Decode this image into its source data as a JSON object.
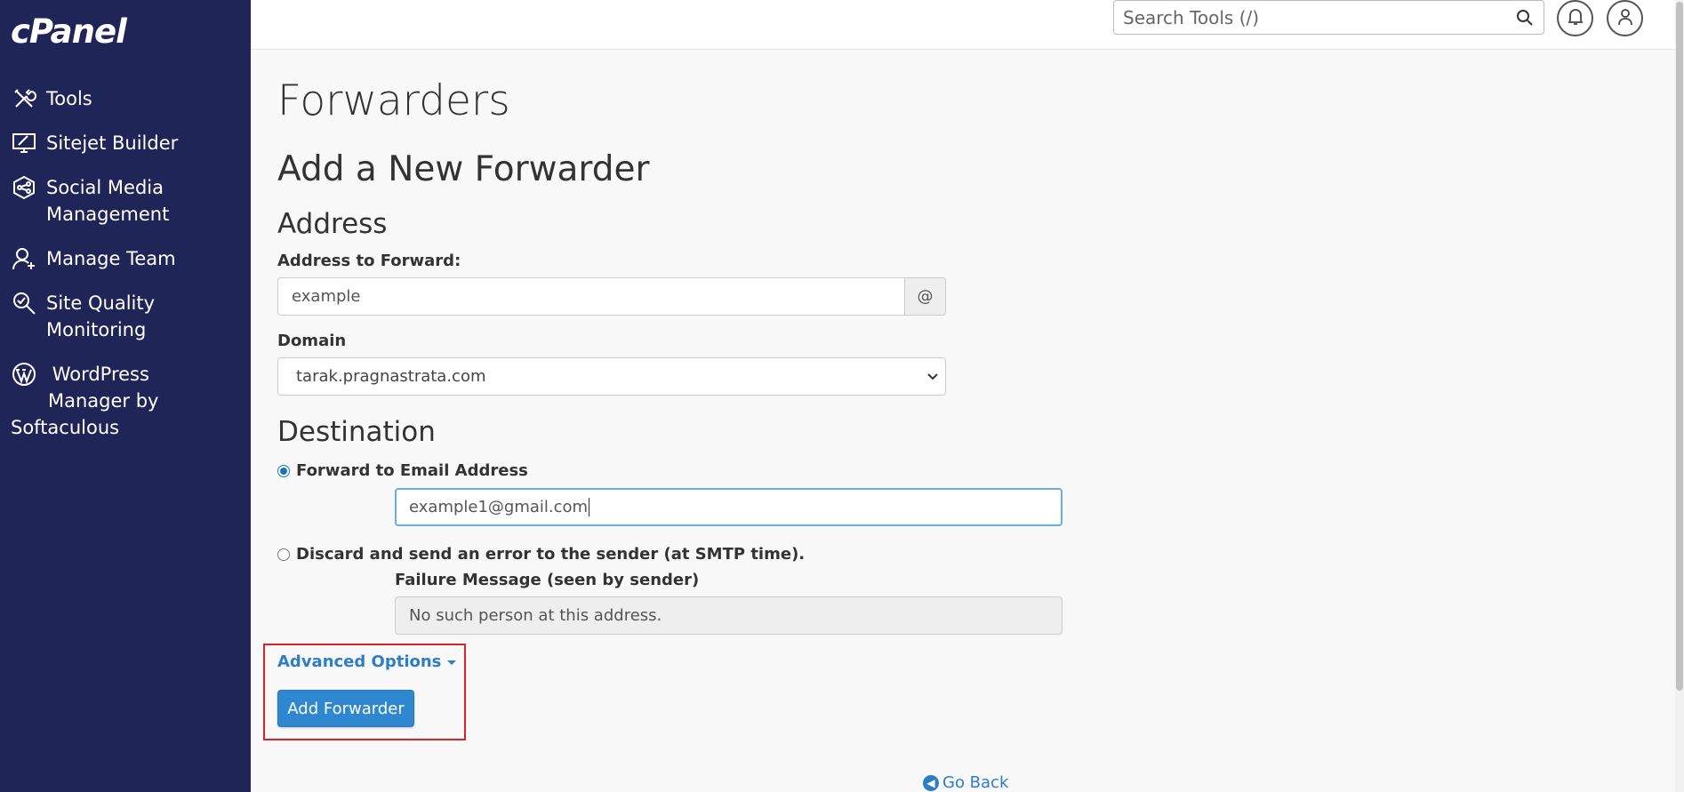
{
  "app": {
    "logo": "cPanel"
  },
  "sidebar": {
    "items": [
      {
        "label": "Tools",
        "icon": "tools-icon"
      },
      {
        "label": "Sitejet Builder",
        "icon": "sitejet-icon"
      },
      {
        "label": "Social Media Management",
        "icon": "social-media-icon"
      },
      {
        "label": "Manage Team",
        "icon": "manage-team-icon"
      },
      {
        "label": "Site Quality Monitoring",
        "icon": "site-quality-icon"
      },
      {
        "label": "WordPress Manager by Softaculous",
        "icon": "wordpress-icon"
      }
    ],
    "wp_line1": "WordPress",
    "wp_line2": "Manager by",
    "wp_line3": "Softaculous",
    "social_line1": "Social Media",
    "social_line2": "Management",
    "sqm_line1": "Site Quality",
    "sqm_line2": "Monitoring"
  },
  "topbar": {
    "search_placeholder": "Search Tools (/)"
  },
  "main": {
    "page_title": "Forwarders",
    "section_title": "Add a New Forwarder",
    "address": {
      "heading": "Address",
      "label": "Address to Forward:",
      "value": "example",
      "addon": "@"
    },
    "domain": {
      "label": "Domain",
      "selected": "tarak.pragnastrata.com"
    },
    "destination": {
      "heading": "Destination",
      "forward_label": "Forward to Email Address",
      "forward_value": "example1@gmail.com",
      "discard_label": "Discard and send an error to the sender (at SMTP time).",
      "failure_label": "Failure Message (seen by sender)",
      "failure_value": "No such person at this address."
    },
    "advanced_options": "Advanced Options",
    "submit": "Add Forwarder",
    "go_back": "Go Back"
  },
  "colors": {
    "sidebar_bg": "#1f2557",
    "primary": "#2f87d0",
    "link": "#2d7ec4",
    "highlight": "#d6222a"
  }
}
